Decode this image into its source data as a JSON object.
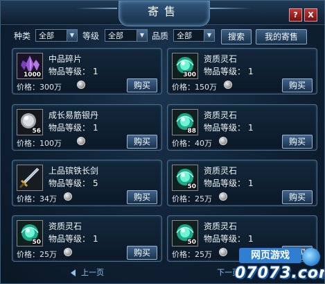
{
  "window": {
    "title": "寄售",
    "help_label": "?",
    "close_label": "X"
  },
  "filters": {
    "category_label": "种类",
    "category_value": "全部",
    "level_label": "等级",
    "level_value": "全部",
    "quality_label": "品质",
    "quality_value": "全部",
    "search_label": "搜索",
    "my_consign_label": "我的寄售"
  },
  "labels": {
    "level_prefix": "物品等级：",
    "price_prefix": "价格：",
    "buy": "购买"
  },
  "items": [
    {
      "name": "中品碎片",
      "level": "1",
      "price": "300万",
      "qty": "1000",
      "icon": "purple-shard-icon"
    },
    {
      "name": "资质灵石",
      "level": "1",
      "price": "150万",
      "qty": "300",
      "icon": "green-spirit-stone-icon"
    },
    {
      "name": "成长易筋银丹",
      "level": "1",
      "price": "100万",
      "qty": "56",
      "icon": "silver-pill-icon"
    },
    {
      "name": "资质灵石",
      "level": "1",
      "price": "40万",
      "qty": "88",
      "icon": "green-spirit-stone-icon"
    },
    {
      "name": "上品镔铁长剑",
      "level": "5",
      "price": "34万",
      "qty": "",
      "icon": "sword-icon"
    },
    {
      "name": "资质灵石",
      "level": "1",
      "price": "25万",
      "qty": "50",
      "icon": "green-spirit-stone-icon"
    },
    {
      "name": "资质灵石",
      "level": "1",
      "price": "25万",
      "qty": "50",
      "icon": "green-spirit-stone-icon"
    },
    {
      "name": "资质灵石",
      "level": "1",
      "price": "25万",
      "qty": "50",
      "icon": "green-spirit-stone-icon"
    }
  ],
  "pager": {
    "prev": "上一页",
    "next": "下一页"
  },
  "watermark": {
    "line1": "网页游戏",
    "line2": "07073.com"
  }
}
